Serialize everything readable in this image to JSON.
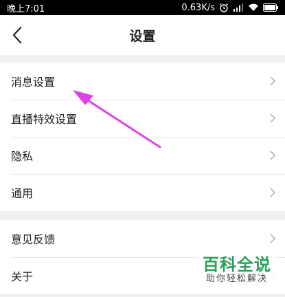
{
  "status_bar": {
    "time": "晚上7:01",
    "speed": "0.63K/s"
  },
  "nav": {
    "title": "设置",
    "back_icon": "back-arrow-icon"
  },
  "group1": [
    {
      "label": "消息设置"
    },
    {
      "label": "直播特效设置"
    },
    {
      "label": "隐私"
    },
    {
      "label": "通用"
    }
  ],
  "group2": [
    {
      "label": "意见反馈"
    },
    {
      "label": "关于"
    }
  ],
  "annotation": {
    "color": "#e040e8"
  },
  "watermark": {
    "main": "百科全说",
    "sub": "助你轻松解决"
  }
}
